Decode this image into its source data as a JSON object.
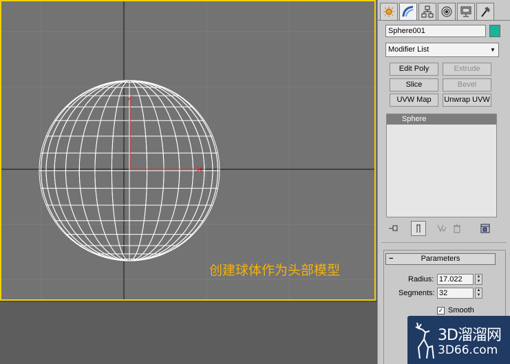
{
  "viewport": {
    "caption": "创建球体作为头部模型",
    "border_color": "#f0d000"
  },
  "command_panel": {
    "tabs": [
      {
        "icon": "create-icon",
        "active": false
      },
      {
        "icon": "modify-icon",
        "active": true
      },
      {
        "icon": "hierarchy-icon",
        "active": false
      },
      {
        "icon": "motion-icon",
        "active": false
      },
      {
        "icon": "display-icon",
        "active": false
      },
      {
        "icon": "utilities-icon",
        "active": false
      }
    ],
    "object_name": "Sphere001",
    "object_color": "#1db39a",
    "modifier_list": "Modifier List",
    "modifier_buttons": {
      "edit_poly": "Edit Poly",
      "extrude": "Extrude",
      "slice": "Slice",
      "bevel": "Bevel",
      "uvw_map": "UVW Map",
      "unwrap_uvw": "Unwrap UVW"
    },
    "stack": [
      "Sphere"
    ],
    "parameters": {
      "title": "Parameters",
      "radius_label": "Radius:",
      "radius_value": "17.022",
      "segments_label": "Segments:",
      "segments_value": "32",
      "smooth_label": "Smooth",
      "smooth_checked": true
    }
  },
  "watermark": {
    "name": "3D溜溜网",
    "url": "3D66.com"
  }
}
